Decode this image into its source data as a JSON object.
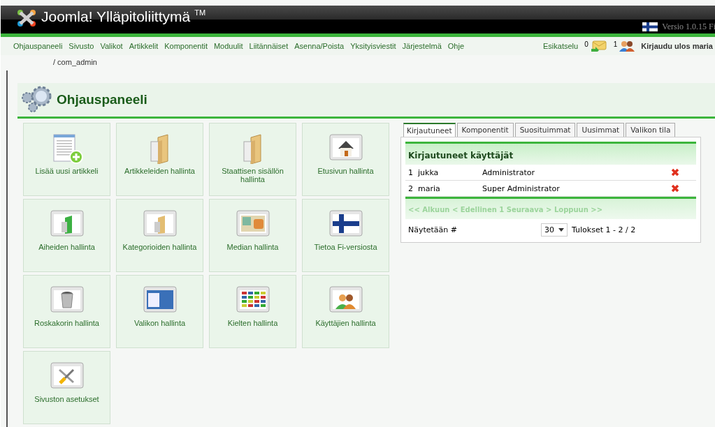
{
  "header": {
    "title": "Joomla! Ylläpitoliittymä",
    "trademark": "TM",
    "version": "Versio 1.0.15 Fi"
  },
  "menu": [
    "Ohjauspaneeli",
    "Sivusto",
    "Valikot",
    "Artikkelit",
    "Komponentit",
    "Moduulit",
    "Liitännäiset",
    "Asenna/Poista",
    "Yksityisviestit",
    "Järjestelmä",
    "Ohje"
  ],
  "status": {
    "preview": "Esikatselu",
    "messages": "0",
    "online": "1",
    "logout": "Kirjaudu ulos maria"
  },
  "breadcrumb": "/ com_admin",
  "page_title": "Ohjauspaneeli",
  "tiles": [
    {
      "label": "Lisää uusi artikkeli",
      "kind": "add-article"
    },
    {
      "label": "Artikkeleiden hallinta",
      "kind": "folder"
    },
    {
      "label": "Staattisen sisällön hallinta",
      "kind": "folder"
    },
    {
      "label": "Etusivun hallinta",
      "kind": "home"
    },
    {
      "label": "Aiheiden hallinta",
      "kind": "green-folder"
    },
    {
      "label": "Kategorioiden hallinta",
      "kind": "small-folder"
    },
    {
      "label": "Median hallinta",
      "kind": "media"
    },
    {
      "label": "Tietoa Fi-versiosta",
      "kind": "flag"
    },
    {
      "label": "Roskakorin hallinta",
      "kind": "trash"
    },
    {
      "label": "Valikon hallinta",
      "kind": "menu"
    },
    {
      "label": "Kielten hallinta",
      "kind": "flags"
    },
    {
      "label": "Käyttäjien hallinta",
      "kind": "users"
    },
    {
      "label": "Sivuston asetukset",
      "kind": "tools"
    }
  ],
  "tabs": [
    {
      "label": "Kirjautuneet",
      "selected": true
    },
    {
      "label": "Komponentit",
      "selected": false
    },
    {
      "label": "Suosituimmat",
      "selected": false
    },
    {
      "label": "Uusimmat",
      "selected": false
    },
    {
      "label": "Valikon tila",
      "selected": false
    }
  ],
  "users_panel": {
    "heading": "Kirjautuneet käyttäjät",
    "rows": [
      {
        "number": "1",
        "name": "jukka",
        "group": "Administrator"
      },
      {
        "number": "2",
        "name": "maria",
        "group": "Super Administrator"
      }
    ],
    "pagination": "<< Alkuun < Edellinen 1 Seuraava > Loppuun >>",
    "show_label": "Näytetään #",
    "page_size": "30",
    "results": "Tulokset 1 - 2 / 2"
  }
}
